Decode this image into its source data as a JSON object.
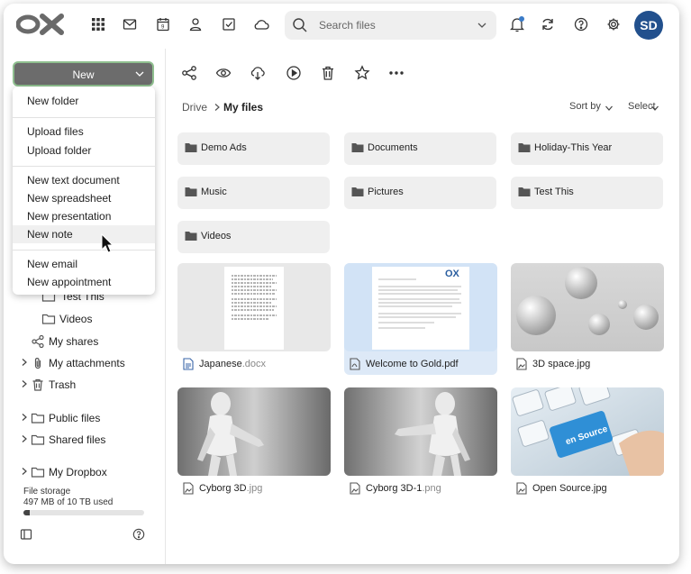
{
  "header": {
    "search_placeholder": "Search files",
    "avatar_initials": "SD",
    "icons": [
      "apps-grid-icon",
      "mail-icon",
      "calendar-icon",
      "contacts-icon",
      "tasks-icon",
      "drive-cloud-icon",
      "bell-icon",
      "refresh-icon",
      "help-icon",
      "settings-gear-icon"
    ]
  },
  "sidebar": {
    "new_button_label": "New",
    "tree": [
      {
        "label": "Test This",
        "icon": "folder-icon"
      },
      {
        "label": "Videos",
        "icon": "folder-icon"
      },
      {
        "label": "My shares",
        "icon": "share-icon"
      },
      {
        "label": "My attachments",
        "icon": "paperclip-icon"
      },
      {
        "label": "Trash",
        "icon": "trash-icon"
      },
      {
        "label": "Public files",
        "icon": "folder-icon"
      },
      {
        "label": "Shared files",
        "icon": "folder-icon"
      },
      {
        "label": "My Dropbox",
        "icon": "folder-icon"
      }
    ],
    "storage_title": "File storage",
    "storage_usage": "497 MB of 10 TB used",
    "storage_fraction": 0.05
  },
  "new_menu": {
    "items": [
      "New folder",
      "Upload files",
      "Upload folder",
      "New text document",
      "New spreadsheet",
      "New presentation",
      "New note",
      "New email",
      "New appointment"
    ],
    "highlighted": "New note"
  },
  "toolbar": {
    "icons": [
      "share-icon",
      "view-eye-icon",
      "download-cloud-icon",
      "play-icon",
      "delete-trash-icon",
      "favorite-star-icon",
      "more-icon"
    ]
  },
  "breadcrumb": {
    "root": "Drive",
    "current": "My files"
  },
  "sort_label": "Sort by",
  "select_label": "Select",
  "folders": [
    "Demo Ads",
    "Documents",
    "Holiday-This Year",
    "Music",
    "Pictures",
    "Test This",
    "Videos"
  ],
  "files": [
    {
      "name": "Japanese",
      "ext": ".docx",
      "type": "doc"
    },
    {
      "name": "Welcome to Gold",
      "ext": ".pdf",
      "type": "pdf",
      "selected": true
    },
    {
      "name": "3D space",
      "ext": ".jpg",
      "type": "image"
    },
    {
      "name": "Cyborg 3D",
      "ext": ".jpg",
      "type": "image"
    },
    {
      "name": "Cyborg 3D-1",
      "ext": ".png",
      "type": "image"
    },
    {
      "name": "Open Source",
      "ext": ".jpg",
      "type": "image"
    }
  ],
  "thumb_texts": {
    "pdf_logo": "OX",
    "keyboard_key": "en Source"
  },
  "colors": {
    "accent": "#22508d",
    "selected_bg": "#dde9f7",
    "new_button": "#6c6c6c"
  }
}
